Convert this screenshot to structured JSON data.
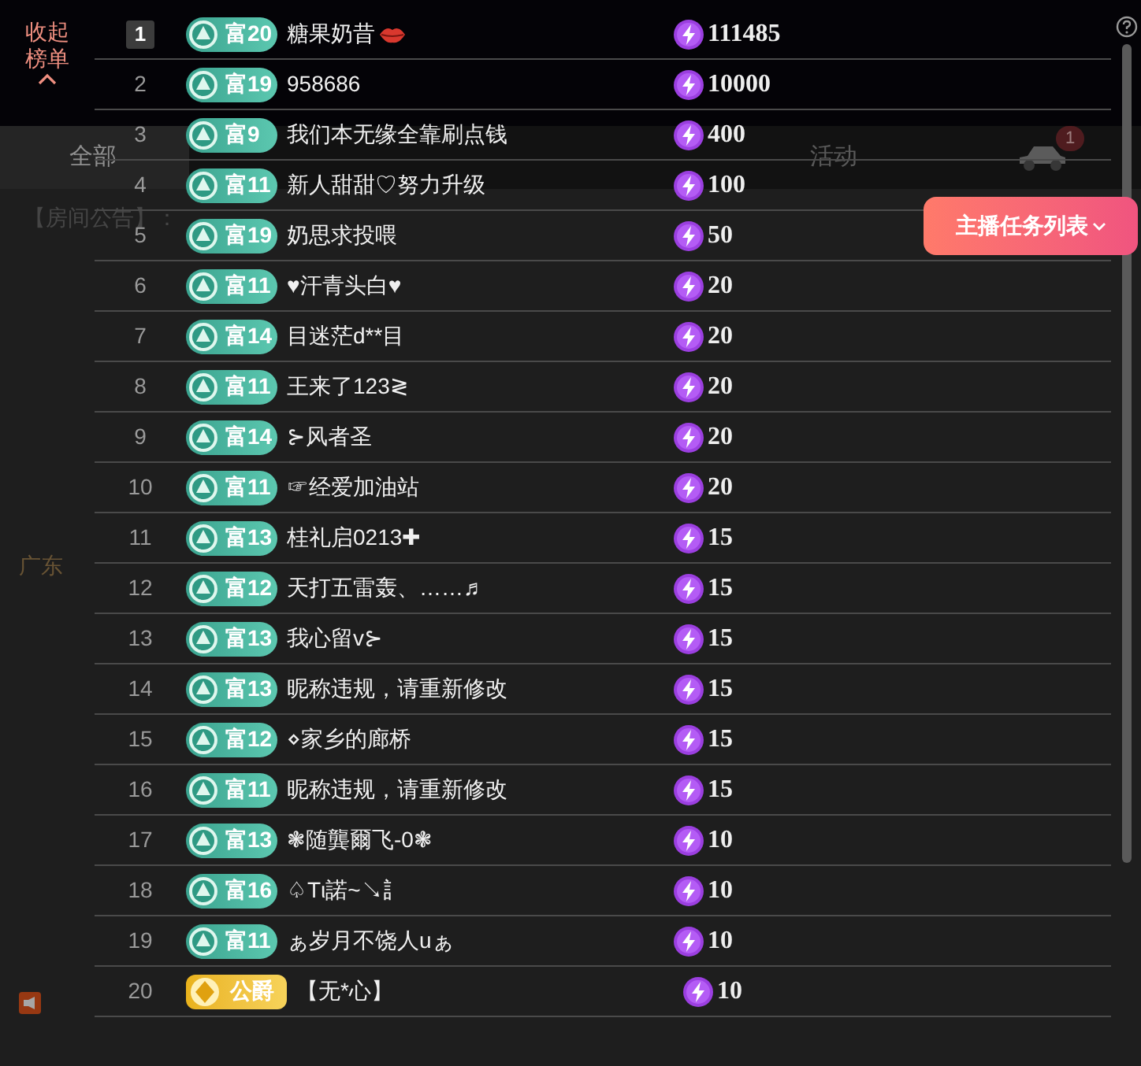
{
  "collapse_button": {
    "label": "收起榜单"
  },
  "tabs": [
    {
      "label": "全部",
      "selected": true
    },
    {
      "label": "活动",
      "selected": false
    }
  ],
  "car_badge": "1",
  "announcement": "【房间公告】：",
  "region": "广东",
  "task_button": "主播任务列表",
  "leaderboard": [
    {
      "rank": "1",
      "top": true,
      "badge": "富20",
      "kind": "wealth",
      "name": "糖果奶昔",
      "lips": true,
      "value": "111485"
    },
    {
      "rank": "2",
      "top": false,
      "badge": "富19",
      "kind": "wealth",
      "name": "958686",
      "lips": false,
      "value": "10000"
    },
    {
      "rank": "3",
      "top": false,
      "badge": "富9",
      "kind": "wealth",
      "name": "我们本无缘全靠刷点钱",
      "lips": false,
      "value": "400"
    },
    {
      "rank": "4",
      "top": false,
      "badge": "富11",
      "kind": "wealth",
      "name": "新人甜甜♡努力升级",
      "lips": false,
      "value": "100"
    },
    {
      "rank": "5",
      "top": false,
      "badge": "富19",
      "kind": "wealth",
      "name": "奶思求投喂",
      "lips": false,
      "value": "50"
    },
    {
      "rank": "6",
      "top": false,
      "badge": "富11",
      "kind": "wealth",
      "name": "♥汗青头白♥",
      "lips": false,
      "value": "20"
    },
    {
      "rank": "7",
      "top": false,
      "badge": "富14",
      "kind": "wealth",
      "name": "目迷茫d**目",
      "lips": false,
      "value": "20"
    },
    {
      "rank": "8",
      "top": false,
      "badge": "富11",
      "kind": "wealth",
      "name": "王来了123≷",
      "lips": false,
      "value": "20"
    },
    {
      "rank": "9",
      "top": false,
      "badge": "富14",
      "kind": "wealth",
      "name": "⊱风者圣",
      "lips": false,
      "value": "20"
    },
    {
      "rank": "10",
      "top": false,
      "badge": "富11",
      "kind": "wealth",
      "name": "☞经爱加油站",
      "lips": false,
      "value": "20"
    },
    {
      "rank": "11",
      "top": false,
      "badge": "富13",
      "kind": "wealth",
      "name": "桂礼启0213✚",
      "lips": false,
      "value": "15"
    },
    {
      "rank": "12",
      "top": false,
      "badge": "富12",
      "kind": "wealth",
      "name": "天打五雷轰、……♬",
      "lips": false,
      "value": "15"
    },
    {
      "rank": "13",
      "top": false,
      "badge": "富13",
      "kind": "wealth",
      "name": "我心留v⊱",
      "lips": false,
      "value": "15"
    },
    {
      "rank": "14",
      "top": false,
      "badge": "富13",
      "kind": "wealth",
      "name": "昵称违规，请重新修改",
      "lips": false,
      "value": "15"
    },
    {
      "rank": "15",
      "top": false,
      "badge": "富12",
      "kind": "wealth",
      "name": "⋄家乡的廊桥",
      "lips": false,
      "value": "15"
    },
    {
      "rank": "16",
      "top": false,
      "badge": "富11",
      "kind": "wealth",
      "name": "昵称违规，请重新修改",
      "lips": false,
      "value": "15"
    },
    {
      "rank": "17",
      "top": false,
      "badge": "富13",
      "kind": "wealth",
      "name": "❃随龔爾飞-0❃",
      "lips": false,
      "value": "10"
    },
    {
      "rank": "18",
      "top": false,
      "badge": "富16",
      "kind": "wealth",
      "name": "♤Tι諾~↘訁",
      "lips": false,
      "value": "10"
    },
    {
      "rank": "19",
      "top": false,
      "badge": "富11",
      "kind": "wealth",
      "name": "ぁ岁月不饶人uぁ",
      "lips": false,
      "value": "10"
    },
    {
      "rank": "20",
      "top": false,
      "badge": "公爵",
      "kind": "noble",
      "name": "【无*心】",
      "lips": false,
      "value": "10"
    }
  ]
}
